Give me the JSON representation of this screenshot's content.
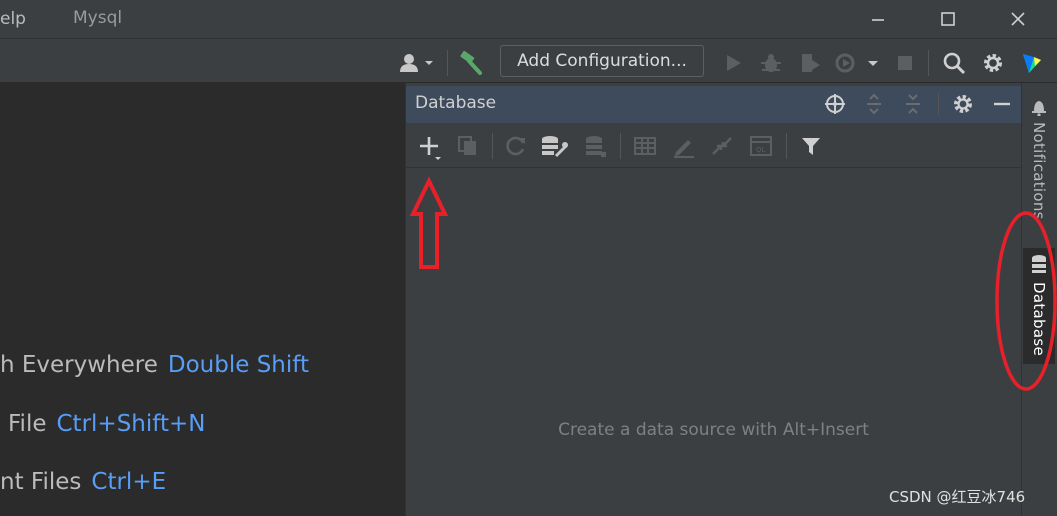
{
  "titlebar": {
    "menu_fragment": "elp",
    "project": "Mysql"
  },
  "toolbar": {
    "add_configuration": "Add Configuration..."
  },
  "welcome": {
    "hints": [
      {
        "label": "h Everywhere",
        "key": "Double Shift"
      },
      {
        "label": "File",
        "key": "Ctrl+Shift+N"
      },
      {
        "label": "nt Files",
        "key": "Ctrl+E"
      }
    ]
  },
  "database_panel": {
    "title": "Database",
    "empty_text": "Create a data source with Alt+Insert"
  },
  "right_stripe": {
    "tabs": [
      {
        "label": "Notifications"
      },
      {
        "label": "Database"
      }
    ]
  },
  "watermark": "CSDN @红豆冰746",
  "colors": {
    "background": "#2b2b2b",
    "panel": "#3c3f41",
    "panel_header": "#3d4b5c",
    "link_blue": "#589df6",
    "annotation_red": "#e8202a",
    "build_green": "#59a869"
  }
}
